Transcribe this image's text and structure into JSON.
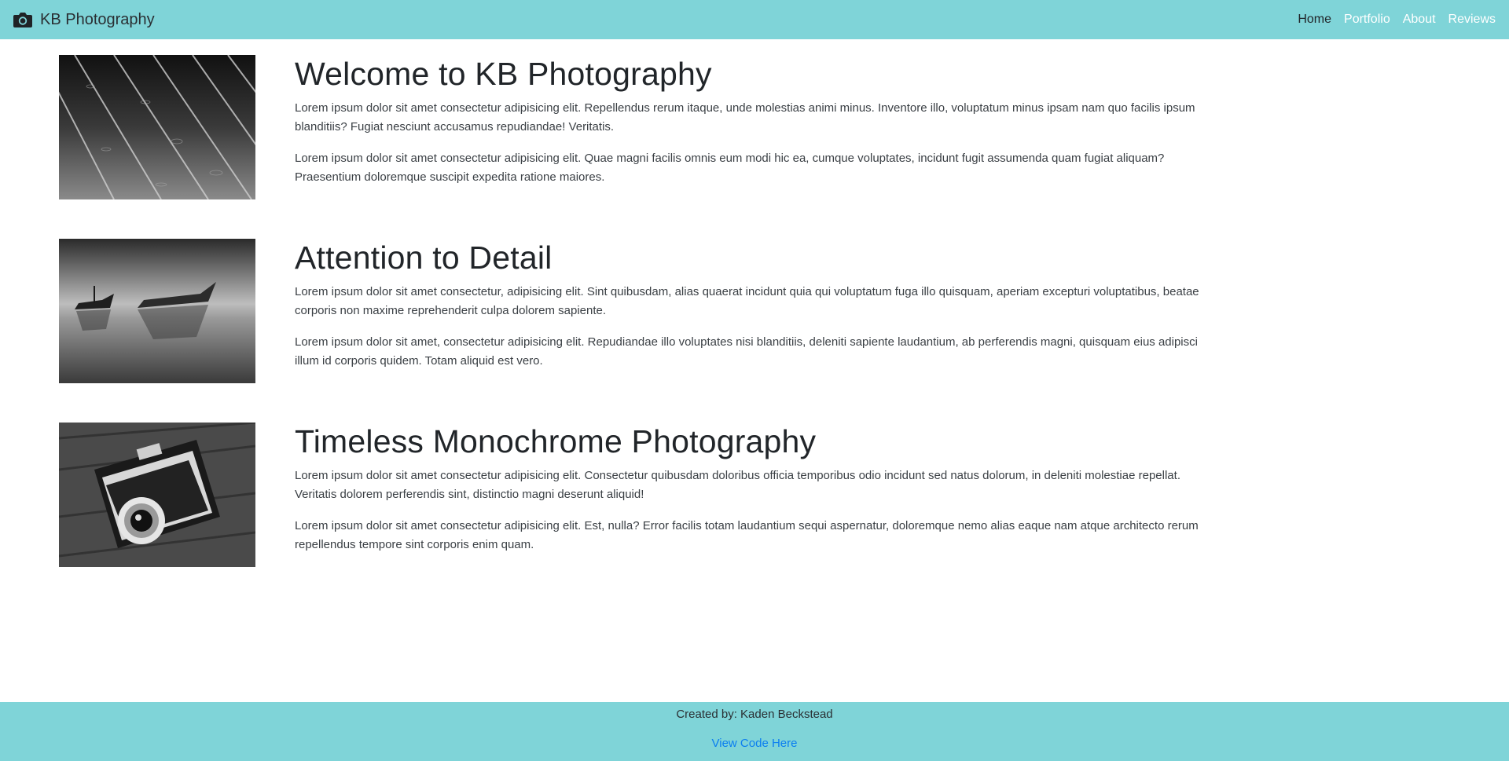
{
  "navbar": {
    "brand_icon": "camera-icon",
    "brand": "KB Photography",
    "links": [
      {
        "label": "Home"
      },
      {
        "label": "Portfolio"
      },
      {
        "label": "About"
      },
      {
        "label": "Reviews"
      }
    ]
  },
  "features": [
    {
      "image": "rain-on-wooden-deck-photo",
      "title": "Welcome to KB Photography",
      "paragraphs": [
        "Lorem ipsum dolor sit amet consectetur adipisicing elit. Repellendus rerum itaque, unde molestias animi minus. Inventore illo, voluptatum minus ipsam nam quo facilis ipsum blanditiis? Fugiat nesciunt accusamus repudiandae! Veritatis.",
        "Lorem ipsum dolor sit amet consectetur adipisicing elit. Quae magni facilis omnis eum modi hic ea, cumque voluptates, incidunt fugit assumenda quam fugiat aliquam? Praesentium doloremque suscipit expedita ratione maiores."
      ]
    },
    {
      "image": "shipwreck-boats-photo",
      "title": "Attention to Detail",
      "paragraphs": [
        "Lorem ipsum dolor sit amet consectetur, adipisicing elit. Sint quibusdam, alias quaerat incidunt quia qui voluptatum fuga illo quisquam, aperiam excepturi voluptatibus, beatae corporis non maxime reprehenderit culpa dolorem sapiente.",
        "Lorem ipsum dolor sit amet, consectetur adipisicing elit. Repudiandae illo voluptates nisi blanditiis, deleniti sapiente laudantium, ab perferendis magni, quisquam eius adipisci illum id corporis quidem. Totam aliquid est vero."
      ]
    },
    {
      "image": "vintage-camera-photo",
      "title": "Timeless Monochrome Photography",
      "paragraphs": [
        "Lorem ipsum dolor sit amet consectetur adipisicing elit. Consectetur quibusdam doloribus officia temporibus odio incidunt sed natus dolorum, in deleniti molestiae repellat. Veritatis dolorem perferendis sint, distinctio magni deserunt aliquid!",
        "Lorem ipsum dolor sit amet consectetur adipisicing elit. Est, nulla? Error facilis totam laudantium sequi aspernatur, doloremque nemo alias eaque nam atque architecto rerum repellendus tempore sint corporis enim quam."
      ]
    }
  ],
  "footer": {
    "credit": "Created by: Kaden Beckstead",
    "link": "View Code Here"
  },
  "colors": {
    "bar": "#7fd4d8",
    "link": "#0b7ef0",
    "text": "#212529"
  }
}
